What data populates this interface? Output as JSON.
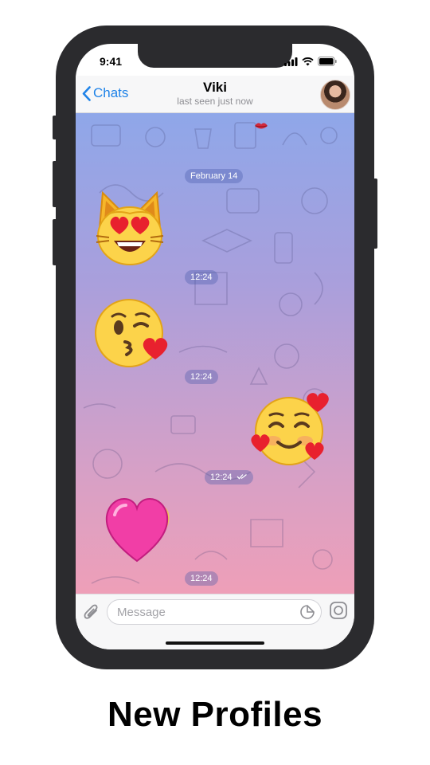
{
  "status": {
    "time": "9:41"
  },
  "nav": {
    "back_label": "Chats",
    "title": "Viki",
    "subtitle": "last seen just now"
  },
  "chat": {
    "date_divider": "February 14",
    "messages": [
      {
        "sticker": "heart-eyes-cat",
        "time": "12:24",
        "outgoing": false
      },
      {
        "sticker": "kissing-face",
        "time": "12:24",
        "outgoing": false
      },
      {
        "sticker": "smiling-face-with-hearts",
        "time": "12:24",
        "outgoing": true
      },
      {
        "sticker": "pink-heart",
        "time": "12:24",
        "outgoing": false
      }
    ]
  },
  "input": {
    "placeholder": "Message"
  },
  "caption": "New Profiles",
  "colors": {
    "accent": "#1f83e8",
    "frame": "#2b2b2e"
  }
}
